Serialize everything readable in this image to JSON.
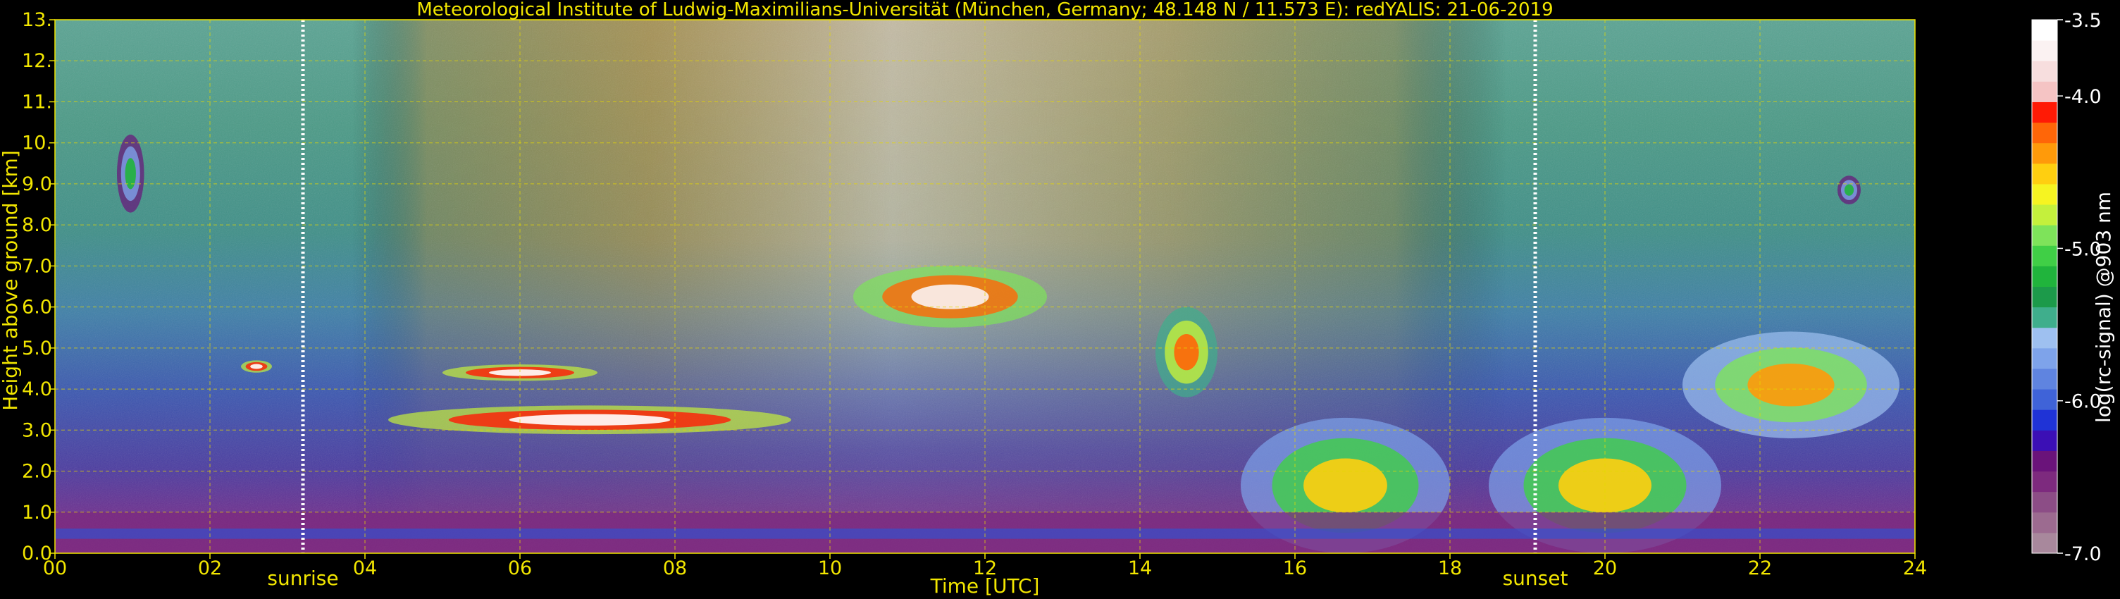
{
  "chart_data": {
    "type": "heatmap",
    "title": "Meteorological Institute of Ludwig-Maximilians-Universität (München, Germany; 48.148 N / 11.573 E):    redYALIS: 21-06-2019",
    "xlabel": "Time [UTC]",
    "ylabel": "Height above ground [km]",
    "xlim": [
      0,
      24
    ],
    "ylim": [
      0,
      13
    ],
    "x_ticks": [
      {
        "value": 0,
        "label": "00"
      },
      {
        "value": 2,
        "label": "02"
      },
      {
        "value": 4,
        "label": "04"
      },
      {
        "value": 6,
        "label": "06"
      },
      {
        "value": 8,
        "label": "08"
      },
      {
        "value": 10,
        "label": "10"
      },
      {
        "value": 12,
        "label": "12"
      },
      {
        "value": 14,
        "label": "14"
      },
      {
        "value": 16,
        "label": "16"
      },
      {
        "value": 18,
        "label": "18"
      },
      {
        "value": 20,
        "label": "20"
      },
      {
        "value": 22,
        "label": "22"
      },
      {
        "value": 24,
        "label": "24"
      }
    ],
    "y_ticks": [
      {
        "value": 0,
        "label": "0.0"
      },
      {
        "value": 1,
        "label": "1.0"
      },
      {
        "value": 2,
        "label": "2.0"
      },
      {
        "value": 3,
        "label": "3.0"
      },
      {
        "value": 4,
        "label": "4.0"
      },
      {
        "value": 5,
        "label": "5.0"
      },
      {
        "value": 6,
        "label": "6.0"
      },
      {
        "value": 7,
        "label": "7.0"
      },
      {
        "value": 8,
        "label": "8.0"
      },
      {
        "value": 9,
        "label": "9.0"
      },
      {
        "value": 10,
        "label": "10."
      },
      {
        "value": 11,
        "label": "11."
      },
      {
        "value": 12,
        "label": "12."
      },
      {
        "value": 13,
        "label": "13."
      }
    ],
    "grid": true,
    "annotations": [
      {
        "label": "sunrise",
        "x": 3.2
      },
      {
        "label": "sunset",
        "x": 19.1
      }
    ],
    "colorbar": {
      "label": "log(rc-signal) @903 nm",
      "range": [
        -7.0,
        -3.5
      ],
      "ticks": [
        {
          "value": -3.5,
          "label": "-3.5"
        },
        {
          "value": -4.0,
          "label": "-4.0"
        },
        {
          "value": -5.0,
          "label": "-5.0"
        },
        {
          "value": -6.0,
          "label": "-6.0"
        },
        {
          "value": -7.0,
          "label": "-7.0"
        }
      ],
      "colors": [
        "#a8889c",
        "#9c6b90",
        "#8c4d86",
        "#7d2a7e",
        "#6a137a",
        "#3b0fb5",
        "#1f33d6",
        "#3f63d8",
        "#5f84e0",
        "#7ea3ea",
        "#9ec0f0",
        "#3fae8c",
        "#1c9a4a",
        "#20b43c",
        "#40cf46",
        "#7ee35a",
        "#c4f03c",
        "#f6f421",
        "#ffcf10",
        "#ff9a0a",
        "#ff6608",
        "#ff1a05",
        "#f5c4c4",
        "#f7dede",
        "#fbf2f2",
        "#ffffff"
      ]
    },
    "features": [
      {
        "kind": "cloud",
        "x": [
          0.8,
          1.15
        ],
        "y": [
          8.3,
          10.2
        ],
        "value": -5.2
      },
      {
        "kind": "cloud",
        "x": [
          2.4,
          2.8
        ],
        "y": [
          4.4,
          4.7
        ],
        "value": -3.6
      },
      {
        "kind": "cloud",
        "x": [
          4.3,
          9.5
        ],
        "y": [
          2.9,
          3.6
        ],
        "value": -3.6
      },
      {
        "kind": "cloud",
        "x": [
          5.0,
          7.0
        ],
        "y": [
          4.2,
          4.6
        ],
        "value": -3.6
      },
      {
        "kind": "cloud",
        "x": [
          10.3,
          12.8
        ],
        "y": [
          5.5,
          7.0
        ],
        "value": -3.7
      },
      {
        "kind": "cloud",
        "x": [
          14.2,
          15.0
        ],
        "y": [
          3.8,
          6.0
        ],
        "value": -4.3
      },
      {
        "kind": "cloud",
        "x": [
          15.3,
          18.0
        ],
        "y": [
          0.0,
          3.3
        ],
        "value": -4.5
      },
      {
        "kind": "cloud",
        "x": [
          18.5,
          21.5
        ],
        "y": [
          0.0,
          3.3
        ],
        "value": -4.5
      },
      {
        "kind": "cloud",
        "x": [
          21.0,
          23.8
        ],
        "y": [
          2.8,
          5.4
        ],
        "value": -4.4
      },
      {
        "kind": "cloud",
        "x": [
          23.0,
          23.3
        ],
        "y": [
          8.5,
          9.2
        ],
        "value": -5.2
      },
      {
        "kind": "boundary-layer",
        "x": [
          0,
          24
        ],
        "y": [
          0,
          1.0
        ],
        "value": -6.5
      }
    ]
  }
}
